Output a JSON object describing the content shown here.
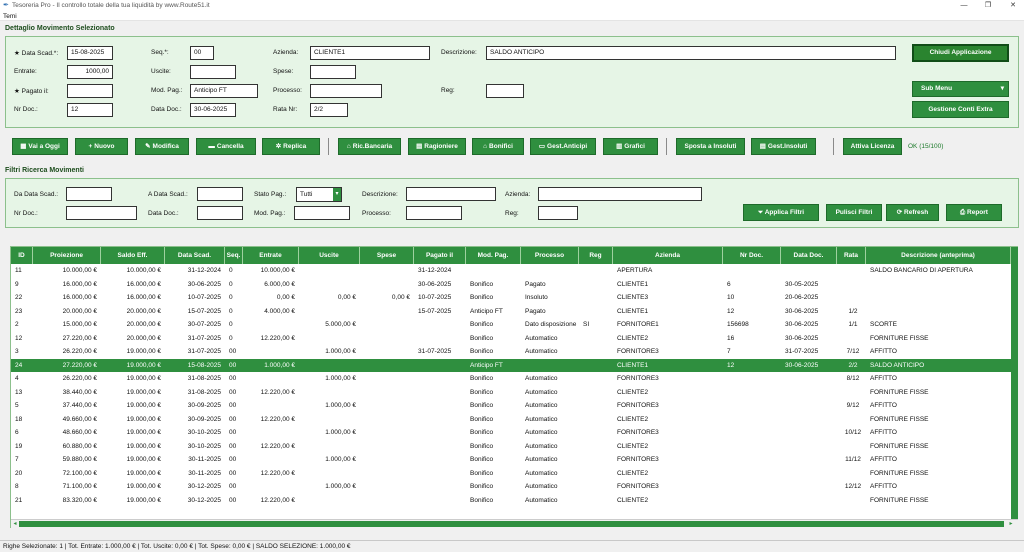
{
  "window": {
    "title": "Tesoreria Pro - Il controllo totale della tua liquidità by www.Route51.it"
  },
  "menu": {
    "temi": "Temi"
  },
  "detail": {
    "section_title": "Dettaglio Movimento Selezionato",
    "data_scad_label": "★ Data Scad.*:",
    "data_scad": "15-08-2025",
    "seq_label": "Seq.*:",
    "seq": "00",
    "azienda_label": "Azienda:",
    "azienda": "CLIENTE1",
    "descrizione_label": "Descrizione:",
    "descrizione": "SALDO ANTICIPO",
    "entrate_label": "Entrate:",
    "entrate": "1000,00",
    "uscite_label": "Uscite:",
    "uscite": "",
    "spese_label": "Spese:",
    "spese": "",
    "pagato_label": "★ Pagato il:",
    "pagato": "",
    "mod_pag_label": "Mod. Pag.:",
    "mod_pag": "Anticipo FT",
    "processo_label": "Processo:",
    "processo": "",
    "reg_label": "Reg:",
    "reg": "",
    "nr_doc_label": "Nr Doc.:",
    "nr_doc": "12",
    "data_doc_label": "Data Doc.:",
    "data_doc": "30-06-2025",
    "rata_label": "Rata Nr:",
    "rata": "2/2",
    "close_btn": "Chiudi Applicazione",
    "submenu_btn": "Sub Menu",
    "submenu_arrow": "▾",
    "gestione_btn": "Gestione Conti Extra"
  },
  "toolbar": {
    "vai_oggi": "Vai a Oggi",
    "nuovo": "Nuovo",
    "modifica": "Modifica",
    "cancella": "Cancella",
    "replica": "Replica",
    "ric_bancaria": "Ric.Bancaria",
    "ragioniere": "Ragioniere",
    "bonifici": "Bonifici",
    "gest_anticipi": "Gest.Anticipi",
    "grafici": "Grafici",
    "sposta_insoluti": "Sposta a Insoluti",
    "gest_insoluti": "Gest.Insoluti",
    "attiva_licenza": "Attiva Licenza",
    "license_status": "OK (15/100)"
  },
  "filters": {
    "section_title": "Filtri Ricerca Movimenti",
    "da_data_label": "Da Data Scad.:",
    "a_data_label": "A Data Scad.:",
    "stato_label": "Stato Pag.:",
    "stato_value": "Tutti",
    "descrizione_label": "Descrizione:",
    "azienda_label": "Azienda:",
    "nr_doc_label": "Nr Doc.:",
    "data_doc_label": "Data Doc.:",
    "mod_pag_label": "Mod. Pag.:",
    "processo_label": "Processo:",
    "reg_label": "Reg:",
    "applica_btn": "Applica Filtri",
    "pulisci_btn": "Pulisci Filtri",
    "refresh_btn": "Refresh",
    "report_btn": "Report"
  },
  "table": {
    "columns": [
      "ID",
      "Proiezione",
      "Saldo Eff.",
      "Data Scad.",
      "Seq.",
      "Entrate",
      "Uscite",
      "Spese",
      "Pagato il",
      "Mod. Pag.",
      "Processo",
      "Reg",
      "Azienda",
      "Nr Doc.",
      "Data Doc.",
      "Rata",
      "Descrizione (anteprima)"
    ],
    "rows": [
      [
        "11",
        "10.000,00 €",
        "10.000,00 €",
        "31-12-2024",
        "0",
        "10.000,00 €",
        "",
        "",
        "31-12-2024",
        "",
        "",
        "",
        "APERTURA",
        "",
        "",
        "",
        "SALDO BANCARIO DI APERTURA"
      ],
      [
        "9",
        "16.000,00 €",
        "16.000,00 €",
        "30-06-2025",
        "0",
        "6.000,00 €",
        "",
        "",
        "30-06-2025",
        "Bonifico",
        "Pagato",
        "",
        "CLIENTE1",
        "6",
        "30-05-2025",
        "",
        ""
      ],
      [
        "22",
        "16.000,00 €",
        "16.000,00 €",
        "10-07-2025",
        "0",
        "0,00 €",
        "0,00 €",
        "0,00 €",
        "10-07-2025",
        "Bonifico",
        "Insoluto",
        "",
        "CLIENTE3",
        "10",
        "20-06-2025",
        "",
        ""
      ],
      [
        "23",
        "20.000,00 €",
        "20.000,00 €",
        "15-07-2025",
        "0",
        "4.000,00 €",
        "",
        "",
        "15-07-2025",
        "Anticipo FT",
        "Pagato",
        "",
        "CLIENTE1",
        "12",
        "30-06-2025",
        "1/2",
        ""
      ],
      [
        "2",
        "15.000,00 €",
        "20.000,00 €",
        "30-07-2025",
        "0",
        "",
        "5.000,00 €",
        "",
        "",
        "Bonifico",
        "Dato disposizione",
        "SI",
        "FORNITORE1",
        "156698",
        "30-06-2025",
        "1/1",
        "SCORTE"
      ],
      [
        "12",
        "27.220,00 €",
        "20.000,00 €",
        "31-07-2025",
        "0",
        "12.220,00 €",
        "",
        "",
        "",
        "Bonifico",
        "Automatico",
        "",
        "CLIENTE2",
        "16",
        "30-06-2025",
        "",
        "FORNITURE FISSE"
      ],
      [
        "3",
        "26.220,00 €",
        "19.000,00 €",
        "31-07-2025",
        "00",
        "",
        "1.000,00 €",
        "",
        "31-07-2025",
        "Bonifico",
        "Automatico",
        "",
        "FORNITORE3",
        "7",
        "31-07-2025",
        "7/12",
        "AFFITTO"
      ],
      [
        "24",
        "27.220,00 €",
        "19.000,00 €",
        "15-08-2025",
        "00",
        "1.000,00 €",
        "",
        "",
        "",
        "Anticipo FT",
        "",
        "",
        "CLIENTE1",
        "12",
        "30-06-2025",
        "2/2",
        "SALDO  ANTICIPO"
      ],
      [
        "4",
        "26.220,00 €",
        "19.000,00 €",
        "31-08-2025",
        "00",
        "",
        "1.000,00 €",
        "",
        "",
        "Bonifico",
        "Automatico",
        "",
        "FORNITORE3",
        "",
        "",
        "8/12",
        "AFFITTO"
      ],
      [
        "13",
        "38.440,00 €",
        "19.000,00 €",
        "31-08-2025",
        "00",
        "12.220,00 €",
        "",
        "",
        "",
        "Bonifico",
        "Automatico",
        "",
        "CLIENTE2",
        "",
        "",
        "",
        "FORNITURE FISSE"
      ],
      [
        "5",
        "37.440,00 €",
        "19.000,00 €",
        "30-09-2025",
        "00",
        "",
        "1.000,00 €",
        "",
        "",
        "Bonifico",
        "Automatico",
        "",
        "FORNITORE3",
        "",
        "",
        "9/12",
        "AFFITTO"
      ],
      [
        "18",
        "49.660,00 €",
        "19.000,00 €",
        "30-09-2025",
        "00",
        "12.220,00 €",
        "",
        "",
        "",
        "Bonifico",
        "Automatico",
        "",
        "CLIENTE2",
        "",
        "",
        "",
        "FORNITURE FISSE"
      ],
      [
        "6",
        "48.660,00 €",
        "19.000,00 €",
        "30-10-2025",
        "00",
        "",
        "1.000,00 €",
        "",
        "",
        "Bonifico",
        "Automatico",
        "",
        "FORNITORE3",
        "",
        "",
        "10/12",
        "AFFITTO"
      ],
      [
        "19",
        "60.880,00 €",
        "19.000,00 €",
        "30-10-2025",
        "00",
        "12.220,00 €",
        "",
        "",
        "",
        "Bonifico",
        "Automatico",
        "",
        "CLIENTE2",
        "",
        "",
        "",
        "FORNITURE FISSE"
      ],
      [
        "7",
        "59.880,00 €",
        "19.000,00 €",
        "30-11-2025",
        "00",
        "",
        "1.000,00 €",
        "",
        "",
        "Bonifico",
        "Automatico",
        "",
        "FORNITORE3",
        "",
        "",
        "11/12",
        "AFFITTO"
      ],
      [
        "20",
        "72.100,00 €",
        "19.000,00 €",
        "30-11-2025",
        "00",
        "12.220,00 €",
        "",
        "",
        "",
        "Bonifico",
        "Automatico",
        "",
        "CLIENTE2",
        "",
        "",
        "",
        "FORNITURE FISSE"
      ],
      [
        "8",
        "71.100,00 €",
        "19.000,00 €",
        "30-12-2025",
        "00",
        "",
        "1.000,00 €",
        "",
        "",
        "Bonifico",
        "Automatico",
        "",
        "FORNITORE3",
        "",
        "",
        "12/12",
        "AFFITTO"
      ],
      [
        "21",
        "83.320,00 €",
        "19.000,00 €",
        "30-12-2025",
        "00",
        "12.220,00 €",
        "",
        "",
        "",
        "Bonifico",
        "Automatico",
        "",
        "CLIENTE2",
        "",
        "",
        "",
        "FORNITURE FISSE"
      ]
    ],
    "selected_row": 7
  },
  "status": {
    "text": "Righe Selezionate: 1   |   Tot. Entrate: 1.000,00 €   |   Tot. Uscite: 0,00 €   |   Tot. Spese: 0,00 €   |   SALDO SELEZIONE: 1.000,00 €"
  },
  "colors": {
    "accent": "#2f8f3f",
    "panel_bg": "#e6f5e6",
    "selected_row": "#2f8f3f"
  }
}
